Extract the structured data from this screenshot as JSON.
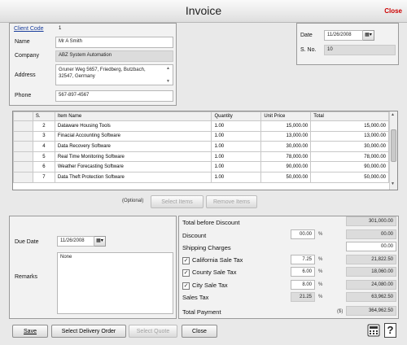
{
  "window": {
    "title": "Invoice",
    "close_label": "Close"
  },
  "client": {
    "client_code_label": "Client Code",
    "client_code": "1",
    "name_label": "Name",
    "name": "Mr A Smith",
    "company_label": "Company",
    "company": "ABZ System Automation",
    "address_label": "Address",
    "address_line1": "Gruner Weg 5657, Friedberg, Butzbach,",
    "address_line2": "32547, Germany",
    "phone_label": "Phone",
    "phone": "567-897-4567"
  },
  "invoice_info": {
    "date_label": "Date",
    "date": "11/26/2008",
    "sno_label": "S. No.",
    "sno": "10"
  },
  "items_table": {
    "columns": [
      "S.",
      "Item Name",
      "Quantity",
      "Unit Price",
      "Total"
    ],
    "rows": [
      {
        "sno": "2",
        "name": "Dataware Housing Tools",
        "qty": "1.00",
        "price": "15,000.00",
        "total": "15,000.00"
      },
      {
        "sno": "3",
        "name": "Finacial Accounting Software",
        "qty": "1.00",
        "price": "13,000.00",
        "total": "13,000.00"
      },
      {
        "sno": "4",
        "name": "Data Recovery Software",
        "qty": "1.00",
        "price": "30,000.00",
        "total": "30,000.00"
      },
      {
        "sno": "5",
        "name": "Real Time Monitoring Software",
        "qty": "1.00",
        "price": "78,000.00",
        "total": "78,000.00"
      },
      {
        "sno": "6",
        "name": "Weather Forecasting Software",
        "qty": "1.00",
        "price": "90,000.00",
        "total": "90,000.00"
      },
      {
        "sno": "7",
        "name": "Data Theft Protection Software",
        "qty": "1.00",
        "price": "50,000.00",
        "total": "50,000.00"
      }
    ]
  },
  "item_actions": {
    "optional_label": "(Optional)",
    "select_items": "Select Items",
    "remove_items": "Remove Items"
  },
  "due": {
    "due_date_label": "Due Date",
    "due_date": "11/26/2008",
    "remarks_label": "Remarks",
    "remarks": "None"
  },
  "summary": {
    "total_before_discount_label": "Total before Discount",
    "total_before_discount": "301,000.00",
    "discount_label": "Discount",
    "discount_pct": "00.00",
    "discount": "00.00",
    "shipping_label": "Shipping Charges",
    "shipping": "00.00",
    "ca_tax_label": "California Sale Tax",
    "ca_tax_pct": "7.25",
    "ca_tax": "21,822.50",
    "county_tax_label": "County Sale Tax",
    "county_tax_pct": "6.00",
    "county_tax": "18,060.00",
    "city_tax_label": "City Sale Tax",
    "city_tax_pct": "8.00",
    "city_tax": "24,080.00",
    "sales_tax_label": "Sales Tax",
    "sales_tax_pct": "21.25",
    "sales_tax": "63,962.50",
    "total_payment_label": "Total Payment",
    "currency": "($)",
    "total_payment": "364,962.50",
    "percent_sign": "%"
  },
  "footer": {
    "save": "Save",
    "select_delivery_order": "Select Delivery Order",
    "select_quote": "Select Quote",
    "close": "Close"
  },
  "icons": {
    "calendar": "calendar-icon",
    "calculator": "calculator-icon",
    "help": "help-icon",
    "dropdown": "chevron-down-icon"
  }
}
